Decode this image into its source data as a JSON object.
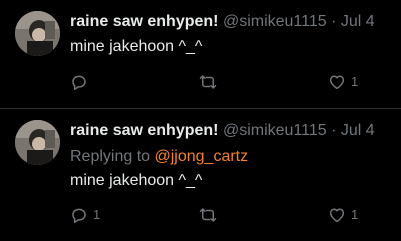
{
  "tweets": [
    {
      "display_name": "raine saw enhypen!",
      "handle": "@simikeu1115",
      "separator": "·",
      "date": "Jul 4",
      "replying_prefix": "",
      "replying_to": "",
      "text": "mine jakehoon ^_^",
      "reply_count": "",
      "retweet_count": "",
      "like_count": "1"
    },
    {
      "display_name": "raine saw enhypen!",
      "handle": "@simikeu1115",
      "separator": "·",
      "date": "Jul 4",
      "replying_prefix": "Replying to ",
      "replying_to": "@jjong_cartz",
      "text": "mine jakehoon ^_^",
      "reply_count": "1",
      "retweet_count": "",
      "like_count": "1"
    }
  ],
  "icons": {
    "reply": "reply-bubble-icon",
    "retweet": "retweet-icon",
    "like": "heart-icon"
  },
  "colors": {
    "background": "#000000",
    "text": "#e7e9ea",
    "muted": "#71767b",
    "mention": "#f4802a",
    "divider": "#2f3336"
  }
}
